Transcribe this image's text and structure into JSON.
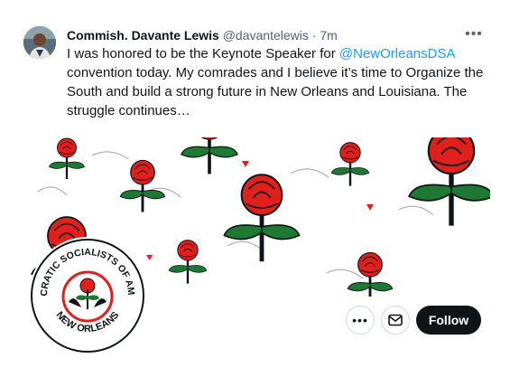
{
  "tweet": {
    "display_name": "Commish. Davante Lewis",
    "handle": "@davantelewis",
    "separator": "·",
    "time": "7m",
    "text_before": "I was honored to be the Keynote Speaker for ",
    "mention": "@NewOrleansDSA",
    "text_after": " convention today. My comrades and I believe it’s time to Organize the South and build a strong future in New Orleans and Louisiana. The struggle continues…"
  },
  "badge": {
    "top_text": "DEMOCRATIC SOCIALISTS OF AMERICA",
    "bottom_text": "NEW ORLEANS"
  },
  "actions": {
    "more_icon": "more-horizontal-icon",
    "mail_icon": "envelope-icon",
    "follow_label": "Follow"
  },
  "colors": {
    "rose_red": "#e0201c",
    "leaf_green": "#1e7a33",
    "follow_bg": "#0f1419",
    "mention": "#1d9bf0"
  }
}
